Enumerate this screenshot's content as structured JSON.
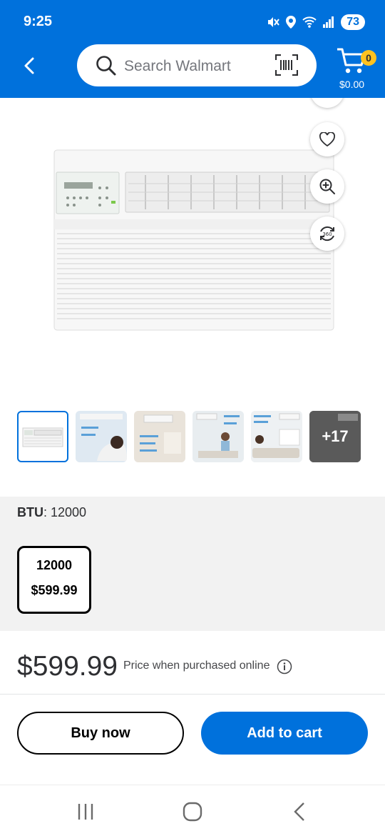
{
  "status_bar": {
    "time": "9:25",
    "battery": "73",
    "icons": [
      "mute-icon",
      "location-icon",
      "wifi-icon",
      "signal-icon",
      "battery-icon"
    ]
  },
  "header": {
    "search_placeholder": "Search Walmart",
    "cart_count": "0",
    "cart_total": "$0.00"
  },
  "gallery": {
    "thumbnails": [
      {
        "name": "thumbnail-front-view",
        "selected": true
      },
      {
        "name": "thumbnail-quiet-operation"
      },
      {
        "name": "thumbnail-easy-installation"
      },
      {
        "name": "thumbnail-remote-use"
      },
      {
        "name": "thumbnail-living-room"
      },
      {
        "name": "thumbnail-more"
      }
    ],
    "more_label": "+17"
  },
  "variant": {
    "label": "BTU",
    "value": ": 12000",
    "option": {
      "title": "12000",
      "price": "$599.99"
    }
  },
  "pricing": {
    "price": "$599.99",
    "note": "Price when purchased online"
  },
  "actions": {
    "buy_now": "Buy now",
    "add_to_cart": "Add to cart"
  },
  "colors": {
    "brand_blue": "#0071dc",
    "badge_yellow": "#ffc220"
  }
}
